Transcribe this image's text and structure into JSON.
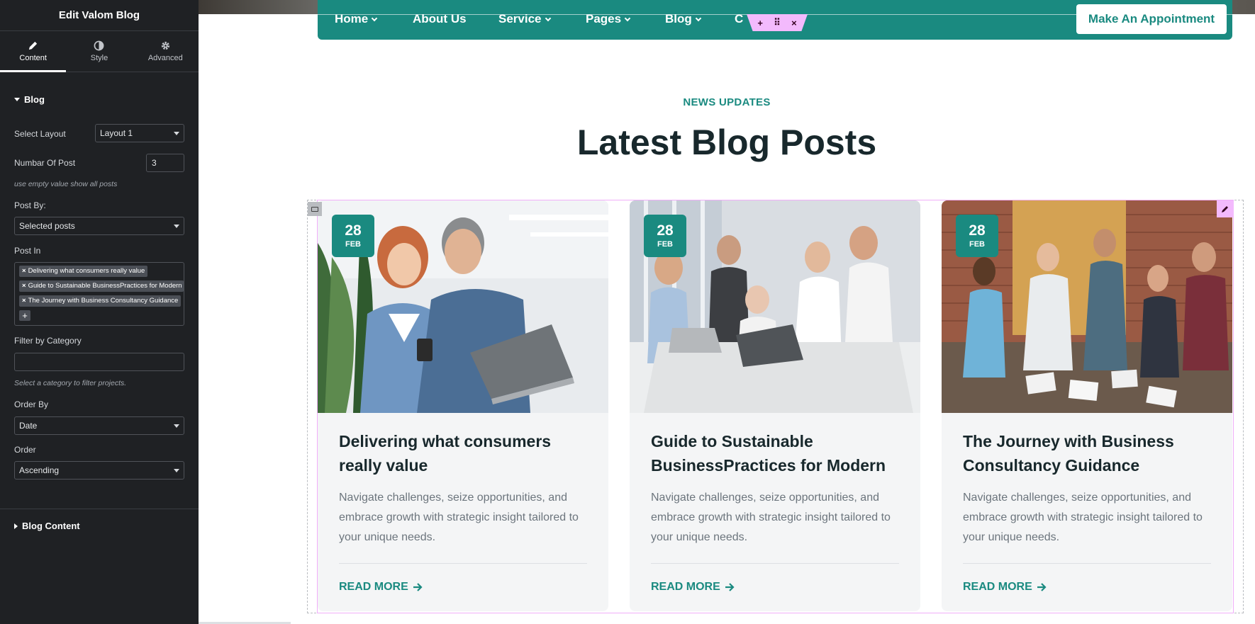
{
  "panel": {
    "title": "Edit Valom Blog",
    "tabs": [
      {
        "label": "Content",
        "icon": "pencil-icon"
      },
      {
        "label": "Style",
        "icon": "half-circle-icon"
      },
      {
        "label": "Advanced",
        "icon": "gear-icon"
      }
    ],
    "blog_section_title": "Blog",
    "select_layout": {
      "label": "Select Layout",
      "value": "Layout 1"
    },
    "number_of_post": {
      "label": "Numbar Of Post",
      "value": "3",
      "help": "use empty value show all posts"
    },
    "post_by": {
      "label": "Post By:",
      "value": "Selected posts"
    },
    "post_in": {
      "label": "Post In",
      "chips": [
        "Delivering what consumers really value",
        "Guide to Sustainable BusinessPractices for Modern",
        "The Journey with Business Consultancy Guidance"
      ],
      "add": "+"
    },
    "filter_by_category": {
      "label": "Filter by Category",
      "value": "",
      "help": "Select a category to filter projects."
    },
    "order_by": {
      "label": "Order By",
      "value": "Date"
    },
    "order": {
      "label": "Order",
      "value": "Ascending"
    },
    "blog_content_section_title": "Blog Content"
  },
  "nav": {
    "items": [
      {
        "label": "Home",
        "dropdown": true
      },
      {
        "label": "About Us",
        "dropdown": false
      },
      {
        "label": "Service",
        "dropdown": true
      },
      {
        "label": "Pages",
        "dropdown": true
      },
      {
        "label": "Blog",
        "dropdown": true
      },
      {
        "label": "C",
        "dropdown": false
      }
    ],
    "cta": "Make An Appointment"
  },
  "toolbar": {
    "add": "+",
    "move": "⠿",
    "close": "×"
  },
  "section": {
    "eyebrow": "NEWS UPDATES",
    "heading": "Latest Blog Posts"
  },
  "posts": [
    {
      "day": "28",
      "month": "FEB",
      "title": "Delivering what consumers really value",
      "excerpt": "Navigate challenges, seize opportunities, and embrace growth with strategic insight tailored to your unique needs.",
      "read_more": "READ MORE"
    },
    {
      "day": "28",
      "month": "FEB",
      "title": "Guide to Sustainable BusinessPractices for Modern",
      "excerpt": "Navigate challenges, seize opportunities, and embrace growth with strategic insight tailored to your unique needs.",
      "read_more": "READ MORE"
    },
    {
      "day": "28",
      "month": "FEB",
      "title": "The Journey with Business Consultancy Guidance",
      "excerpt": "Navigate challenges, seize opportunities, and embrace growth with strategic insight tailored to your unique needs.",
      "read_more": "READ MORE"
    }
  ],
  "colors": {
    "accent": "#1a8a80",
    "panel_bg": "#1f2124",
    "heading": "#18282c",
    "editor_pink": "#f3bafd"
  }
}
